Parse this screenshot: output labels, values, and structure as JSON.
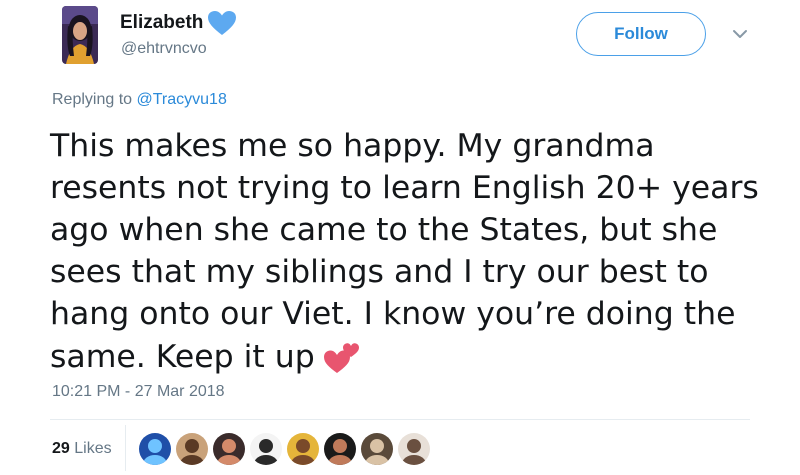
{
  "tweet": {
    "display_name": "Elizabeth",
    "handle": "@ehtrvncvo",
    "follow_label": "Follow",
    "replying_prefix": "Replying to ",
    "replying_to": "@Tracyvu18",
    "text_lines": [
      "This makes me so happy. My grandma",
      "resents not trying to learn English 20+ years",
      "ago when she came to the States, but she",
      "sees that my siblings and I try our best to",
      "hang onto our Viet. I know you’re doing the",
      "same. Keep it up"
    ],
    "emoji": "two-hearts",
    "timestamp": "10:21 PM - 27 Mar 2018",
    "likes_count": "29",
    "likes_label": "Likes"
  },
  "colors": {
    "accent": "#2b8ad9",
    "secondary_text": "#657786",
    "heart_badge": "#5da9f0",
    "emoji_heart": "#e8556f"
  },
  "likers": [
    {
      "name": "liker-avatar-1",
      "bg": "#1f4fa8",
      "fg": "#6fc3ff"
    },
    {
      "name": "liker-avatar-2",
      "bg": "#c9a27a",
      "fg": "#5a3a25"
    },
    {
      "name": "liker-avatar-3",
      "bg": "#3a2b2b",
      "fg": "#d48a6a"
    },
    {
      "name": "liker-avatar-4",
      "bg": "#f4f4f4",
      "fg": "#2a2a2a"
    },
    {
      "name": "liker-avatar-5",
      "bg": "#e5b53a",
      "fg": "#7a4a2a"
    },
    {
      "name": "liker-avatar-6",
      "bg": "#1a1a1a",
      "fg": "#c07a5a"
    },
    {
      "name": "liker-avatar-7",
      "bg": "#5a4a3a",
      "fg": "#d9c2a5"
    },
    {
      "name": "liker-avatar-8",
      "bg": "#e8e0d8",
      "fg": "#6a5040"
    }
  ]
}
